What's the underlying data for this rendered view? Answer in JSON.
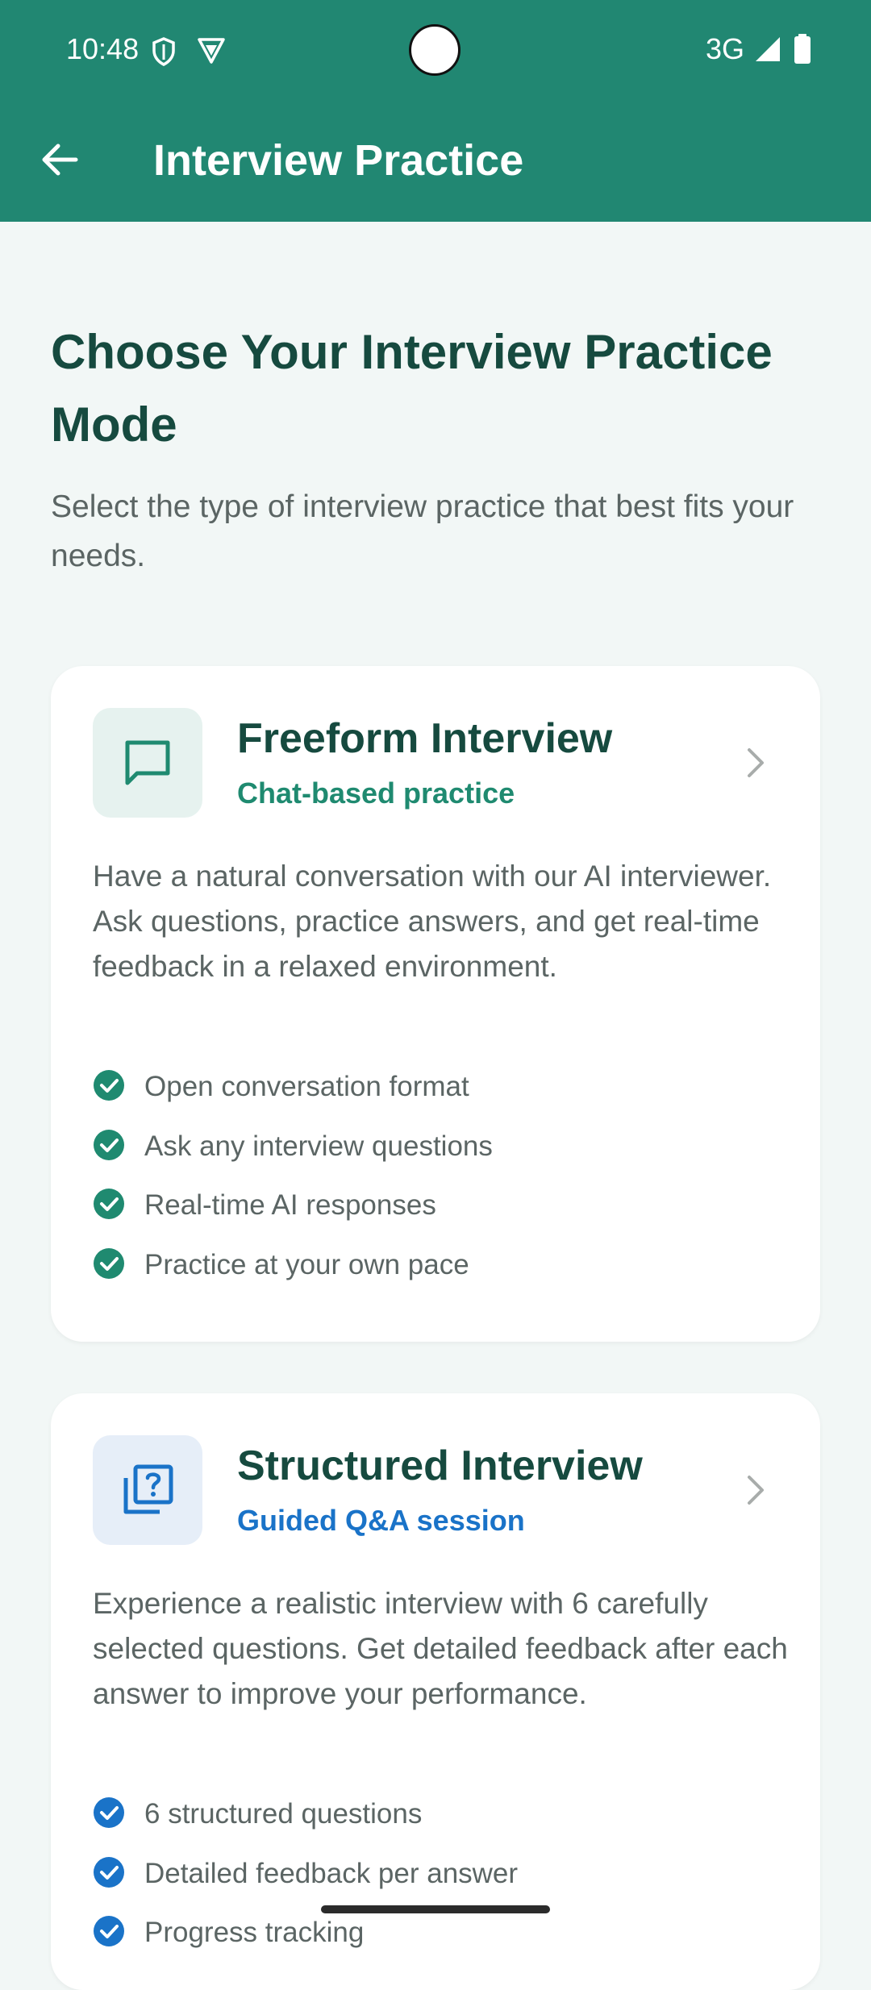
{
  "status_bar": {
    "time": "10:48",
    "network": "3G"
  },
  "app_bar": {
    "title": "Interview Practice"
  },
  "main": {
    "heading": "Choose Your Interview Practice Mode",
    "subtitle": "Select the type of interview practice that best fits your needs."
  },
  "cards": [
    {
      "title": "Freeform Interview",
      "subtitle": "Chat-based practice",
      "icon": "chat-icon",
      "accent": "#1f8a70",
      "icon_bg": "#e6f2ef",
      "description": "Have a natural conversation with our AI interviewer. Ask questions, practice answers, and get real-time feedback in a relaxed environment.",
      "features": [
        "Open conversation format",
        "Ask any interview questions",
        "Real-time AI responses",
        "Practice at your own pace"
      ]
    },
    {
      "title": "Structured Interview",
      "subtitle": "Guided Q&A session",
      "icon": "quiz-icon",
      "accent": "#1a73c8",
      "icon_bg": "#e6eef8",
      "description": "Experience a realistic interview with 6 carefully selected questions. Get detailed feedback after each answer to improve your performance.",
      "features": [
        "6 structured questions",
        "Detailed feedback per answer",
        "Progress tracking"
      ]
    }
  ],
  "colors": {
    "app_bar": "#218772",
    "background": "#f2f7f6",
    "heading": "#164a3f"
  }
}
